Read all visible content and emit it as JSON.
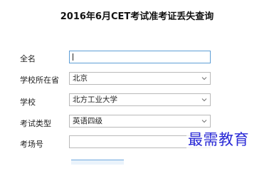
{
  "page": {
    "title": "2016年6月CET考试准考证丢失查询"
  },
  "form": {
    "name": {
      "label": "全名",
      "value": ""
    },
    "province": {
      "label": "学校所在省",
      "value": "北京"
    },
    "school": {
      "label": "学校",
      "value": "北方工业大学"
    },
    "exam_type": {
      "label": "考试类型",
      "value": "英语四级"
    },
    "exam_room": {
      "label": "考场号",
      "value": ""
    }
  },
  "watermark": {
    "text": "最需教育"
  },
  "colors": {
    "focus_border": "#5e9ed6",
    "field_border": "#b9b9b9",
    "watermark": "#2a2ad6"
  },
  "icons": {
    "select_arrow": "chevron-down-icon"
  }
}
